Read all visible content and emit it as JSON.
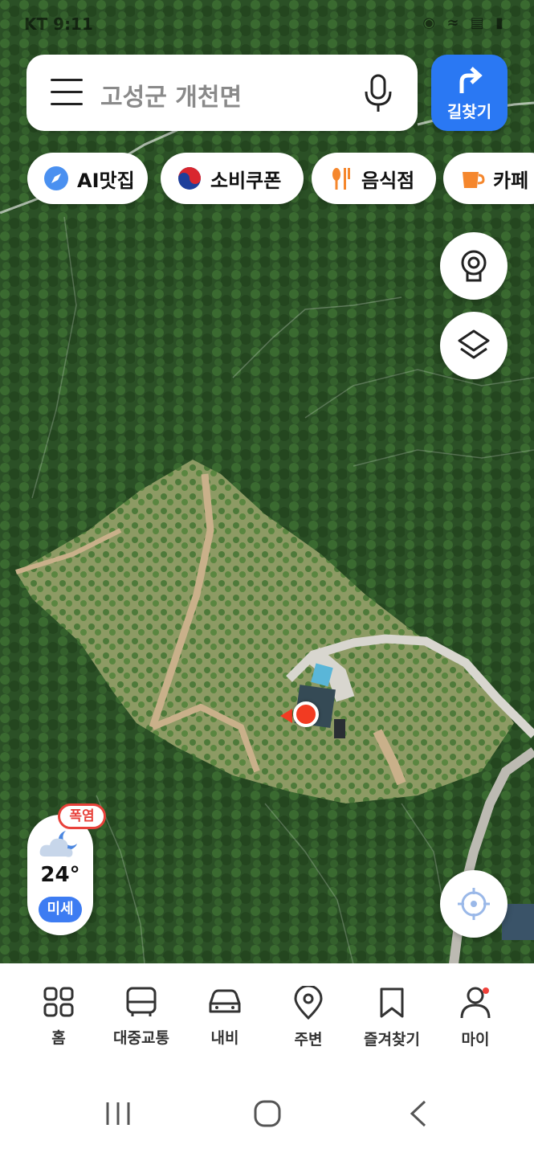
{
  "status_bar": {
    "carrier_time": "KT 9:11",
    "icons": [
      "location-icon",
      "wifi-icon",
      "lte-icon",
      "battery-icon"
    ]
  },
  "search": {
    "query": "고성군 개천면"
  },
  "route_button": {
    "label": "길찾기"
  },
  "chips": [
    {
      "label": "AI맛집",
      "icon": "ai-compass-icon"
    },
    {
      "label": "소비쿠폰",
      "icon": "taegeuk-icon"
    },
    {
      "label": "음식점",
      "icon": "fork-spoon-icon"
    },
    {
      "label": "카페",
      "icon": "coffee-cup-icon"
    }
  ],
  "weather": {
    "alert": "폭염",
    "temperature": "24°",
    "dust": "미세",
    "icon": "cloud-moon-icon"
  },
  "bottom_nav": [
    {
      "label": "홈",
      "icon": "grid-icon"
    },
    {
      "label": "대중교통",
      "icon": "bus-icon"
    },
    {
      "label": "내비",
      "icon": "car-icon"
    },
    {
      "label": "주변",
      "icon": "pin-icon"
    },
    {
      "label": "즐겨찾기",
      "icon": "bookmark-icon"
    },
    {
      "label": "마이",
      "icon": "person-icon"
    }
  ],
  "colors": {
    "accent": "#2a78f3",
    "marker": "#f23b22",
    "alert": "#e8413a",
    "dust": "#3d7cf2"
  }
}
